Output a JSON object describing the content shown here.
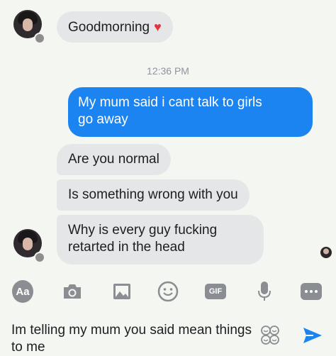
{
  "thread": {
    "messages": [
      {
        "sender": "them",
        "text": "Goodmorning",
        "emoji": "♥"
      },
      {
        "timestamp": "12:36 PM"
      },
      {
        "sender": "me",
        "lines": [
          "My mum said i cant talk to girls",
          "go away"
        ]
      },
      {
        "sender": "them",
        "text": "Are you normal"
      },
      {
        "sender": "them",
        "text": "Is something wrong with you"
      },
      {
        "sender": "them",
        "lines": [
          "Why is every guy fucking",
          "retarted in the head"
        ]
      }
    ]
  },
  "toolbar": {
    "aa_label": "Aa",
    "gif_label": "GIF",
    "icons": [
      "text-format-icon",
      "camera-icon",
      "image-icon",
      "emoji-icon",
      "gif-icon",
      "microphone-icon",
      "more-icon"
    ]
  },
  "composer": {
    "value": "Im telling my mum you said mean things to me"
  },
  "colors": {
    "sent_bubble": "#1b84f0",
    "received_bubble": "#e5e6e8",
    "icon": "#8a8d91",
    "send": "#1b84f0"
  }
}
